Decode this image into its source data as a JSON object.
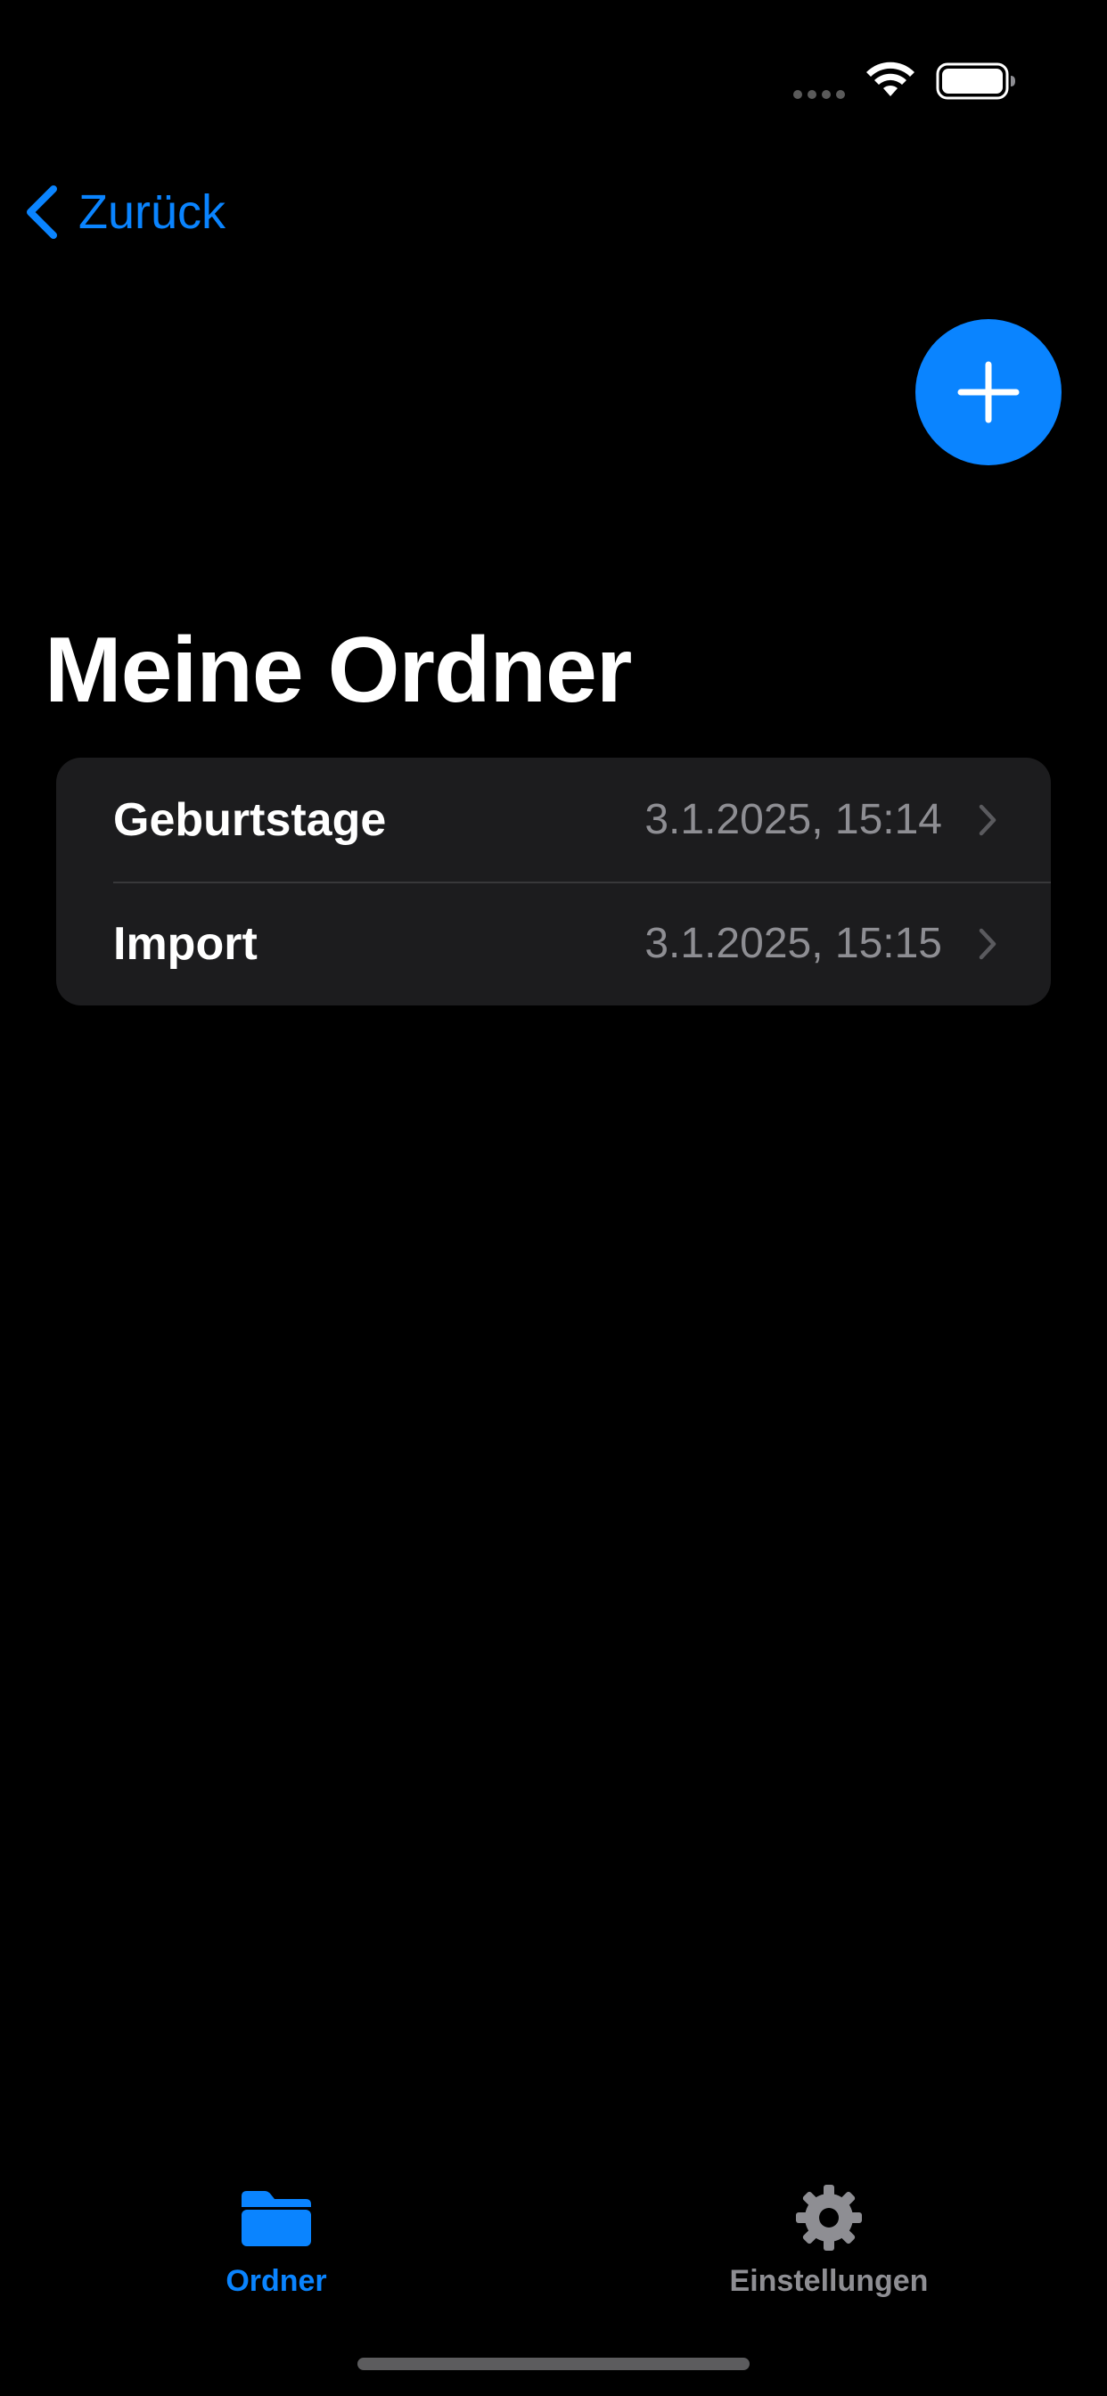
{
  "status_bar": {
    "icons": [
      "signal-dots-icon",
      "wifi-icon",
      "battery-icon"
    ]
  },
  "nav": {
    "back_label": "Zurück",
    "add_icon": "plus-icon"
  },
  "page": {
    "title": "Meine Ordner"
  },
  "folders": [
    {
      "name": "Geburtstage",
      "date": "3.1.2025, 15:14"
    },
    {
      "name": "Import",
      "date": "3.1.2025, 15:15"
    }
  ],
  "tab_bar": {
    "tabs": [
      {
        "label": "Ordner",
        "icon": "folder-icon",
        "selected": true
      },
      {
        "label": "Einstellungen",
        "icon": "gear-icon",
        "selected": false
      }
    ]
  },
  "colors": {
    "background": "#000000",
    "accent": "#0a84ff",
    "card": "#1c1c1e",
    "secondary_text": "#8e8e93"
  }
}
